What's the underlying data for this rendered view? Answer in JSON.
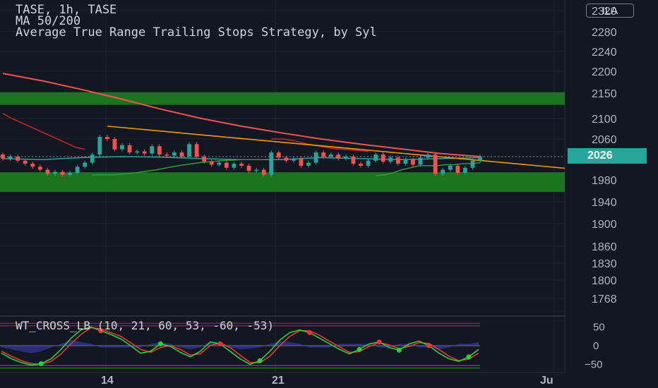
{
  "header": {
    "symbol_line": "TASE, 1h, TASE",
    "ma_line": "MA 50/200",
    "strategy_line": "Average True Range Trailing Stops Strategy, by Syl"
  },
  "currency_badge": "ILA",
  "last_price_label": "2026",
  "oscillator_title": "WT_CROSS_LB (10, 21, 60, 53, -60, -53)",
  "colors": {
    "background": "#131722",
    "ma_fast": "#26a69a",
    "ma_slow": "#ef5350",
    "trendline": "#ff9800",
    "zone": "#1b7a1f",
    "up": "#26a69a",
    "down": "#ef5350",
    "trailing_stop_long": "#2e9a3a",
    "trailing_stop_short": "#c62828",
    "wt1": "#2ecc40",
    "wt2": "#e53935",
    "wt_histogram": "#3f3fbf"
  },
  "chart_data": [
    {
      "type": "candlestick",
      "price_axis_ticks": [
        "2320",
        "2280",
        "2240",
        "2200",
        "2150",
        "2100",
        "2060",
        "2026",
        "1980",
        "1940",
        "1900",
        "1860",
        "1830",
        "1800",
        "1768"
      ],
      "ylim": [
        1740,
        2330
      ],
      "x_ticks": [
        "14",
        "21",
        "Ju"
      ],
      "last_price": 2026,
      "zones": [
        {
          "from": 2127,
          "to": 2152
        },
        {
          "from": 1958,
          "to": 1995
        }
      ],
      "trendline": {
        "start": 2085,
        "end": 2003
      },
      "ma200": [
        2195,
        2178,
        2158,
        2138,
        2118,
        2100,
        2085,
        2072,
        2060,
        2050,
        2041,
        2032,
        2026
      ],
      "ma50": [
        2022,
        2020,
        2024,
        2026,
        2025,
        2022,
        2020,
        2020,
        2024,
        2022,
        2020,
        2022,
        2024
      ],
      "candles": [
        {
          "o": 2030,
          "c": 2022
        },
        {
          "o": 2022,
          "c": 2026
        },
        {
          "o": 2026,
          "c": 2018
        },
        {
          "o": 2018,
          "c": 2012
        },
        {
          "o": 2012,
          "c": 2006
        },
        {
          "o": 2006,
          "c": 2000
        },
        {
          "o": 2000,
          "c": 1992
        },
        {
          "o": 1992,
          "c": 1996
        },
        {
          "o": 1996,
          "c": 1990
        },
        {
          "o": 1990,
          "c": 1994
        },
        {
          "o": 1994,
          "c": 2006
        },
        {
          "o": 2006,
          "c": 2014
        },
        {
          "o": 2014,
          "c": 2030
        },
        {
          "o": 2030,
          "c": 2064
        },
        {
          "o": 2064,
          "c": 2060
        },
        {
          "o": 2060,
          "c": 2040
        },
        {
          "o": 2040,
          "c": 2048
        },
        {
          "o": 2048,
          "c": 2034
        },
        {
          "o": 2034,
          "c": 2036
        },
        {
          "o": 2036,
          "c": 2032
        },
        {
          "o": 2032,
          "c": 2046
        },
        {
          "o": 2046,
          "c": 2030
        },
        {
          "o": 2030,
          "c": 2028
        },
        {
          "o": 2028,
          "c": 2034
        },
        {
          "o": 2034,
          "c": 2026
        },
        {
          "o": 2026,
          "c": 2050
        },
        {
          "o": 2050,
          "c": 2026
        },
        {
          "o": 2026,
          "c": 2016
        },
        {
          "o": 2016,
          "c": 2010
        },
        {
          "o": 2010,
          "c": 2014
        },
        {
          "o": 2014,
          "c": 2004
        },
        {
          "o": 2004,
          "c": 2012
        },
        {
          "o": 2012,
          "c": 2008
        },
        {
          "o": 2008,
          "c": 1998
        },
        {
          "o": 1998,
          "c": 2000
        },
        {
          "o": 2000,
          "c": 1990
        },
        {
          "o": 1990,
          "c": 2034
        },
        {
          "o": 2034,
          "c": 2024
        },
        {
          "o": 2024,
          "c": 2018
        },
        {
          "o": 2018,
          "c": 2022
        },
        {
          "o": 2022,
          "c": 2008
        },
        {
          "o": 2008,
          "c": 2014
        },
        {
          "o": 2014,
          "c": 2034
        },
        {
          "o": 2034,
          "c": 2026
        },
        {
          "o": 2026,
          "c": 2030
        },
        {
          "o": 2030,
          "c": 2022
        },
        {
          "o": 2022,
          "c": 2026
        },
        {
          "o": 2026,
          "c": 2012
        },
        {
          "o": 2012,
          "c": 2008
        },
        {
          "o": 2008,
          "c": 2018
        },
        {
          "o": 2018,
          "c": 2030
        },
        {
          "o": 2030,
          "c": 2016
        },
        {
          "o": 2016,
          "c": 2024
        },
        {
          "o": 2024,
          "c": 2012
        },
        {
          "o": 2012,
          "c": 2020
        },
        {
          "o": 2020,
          "c": 2010
        },
        {
          "o": 2010,
          "c": 2024
        },
        {
          "o": 2024,
          "c": 2030
        },
        {
          "o": 2030,
          "c": 1992
        },
        {
          "o": 1992,
          "c": 2000
        },
        {
          "o": 2000,
          "c": 2008
        },
        {
          "o": 2008,
          "c": 1994
        },
        {
          "o": 1994,
          "c": 2004
        },
        {
          "o": 2004,
          "c": 2018
        },
        {
          "o": 2018,
          "c": 2026
        }
      ],
      "trailing_stop": [
        {
          "side": "short",
          "values": [
            2110,
            2100,
            2092,
            2084,
            2076,
            2068,
            2060,
            2052,
            2044,
            2040
          ]
        },
        {
          "side": "long",
          "values": [
            1990,
            1990,
            1994,
            2000,
            2008,
            2014,
            2018,
            2020,
            2020
          ]
        },
        {
          "side": "short",
          "values": [
            2060,
            2060,
            2056,
            2050,
            2046,
            2042,
            2040,
            2038,
            2036
          ]
        },
        {
          "side": "long",
          "values": [
            1988,
            1990,
            1994,
            2000,
            2004,
            2008,
            2008,
            2008,
            2010,
            2010,
            2012,
            2012,
            2014
          ]
        }
      ]
    },
    {
      "type": "line",
      "name": "WT_CROSS_LB",
      "y_ticks": [
        "50",
        "0",
        "−50"
      ],
      "ylim": [
        -70,
        70
      ],
      "levels": [
        60,
        53,
        -53,
        -60
      ],
      "wt1": [
        -20,
        -35,
        -45,
        -52,
        -48,
        -35,
        -10,
        20,
        42,
        50,
        40,
        30,
        18,
        0,
        -20,
        -15,
        5,
        -2,
        -18,
        -30,
        -15,
        10,
        5,
        -15,
        -35,
        -50,
        -40,
        -15,
        15,
        35,
        42,
        35,
        20,
        5,
        -10,
        -22,
        -10,
        5,
        10,
        -5,
        -12,
        5,
        12,
        0,
        -20,
        -35,
        -42,
        -30,
        -10
      ],
      "wt2": [
        -15,
        -28,
        -40,
        -48,
        -50,
        -42,
        -22,
        5,
        30,
        48,
        45,
        35,
        25,
        8,
        -10,
        -18,
        -5,
        0,
        -10,
        -25,
        -22,
        0,
        8,
        -5,
        -25,
        -45,
        -46,
        -28,
        0,
        25,
        40,
        40,
        28,
        12,
        -3,
        -18,
        -16,
        -2,
        8,
        2,
        -8,
        -2,
        8,
        6,
        -10,
        -28,
        -40,
        -36,
        -20
      ],
      "histogram": [
        -5,
        -10,
        -15,
        -20,
        -15,
        -5,
        5,
        15,
        10,
        5,
        -5,
        -5,
        -5,
        -5,
        -5,
        5,
        10,
        5,
        -5,
        -10,
        -5,
        10,
        5,
        -5,
        -10,
        -8,
        -5,
        5,
        12,
        10,
        5,
        -5,
        -5,
        -5,
        5,
        5,
        5,
        5,
        -5,
        -5,
        5,
        5,
        -5,
        -5,
        -10,
        -5,
        5,
        5,
        10
      ],
      "cross_up_idx": [
        4,
        16,
        26,
        36,
        40,
        47
      ],
      "cross_down_idx": [
        10,
        22,
        31,
        38,
        43
      ]
    }
  ]
}
